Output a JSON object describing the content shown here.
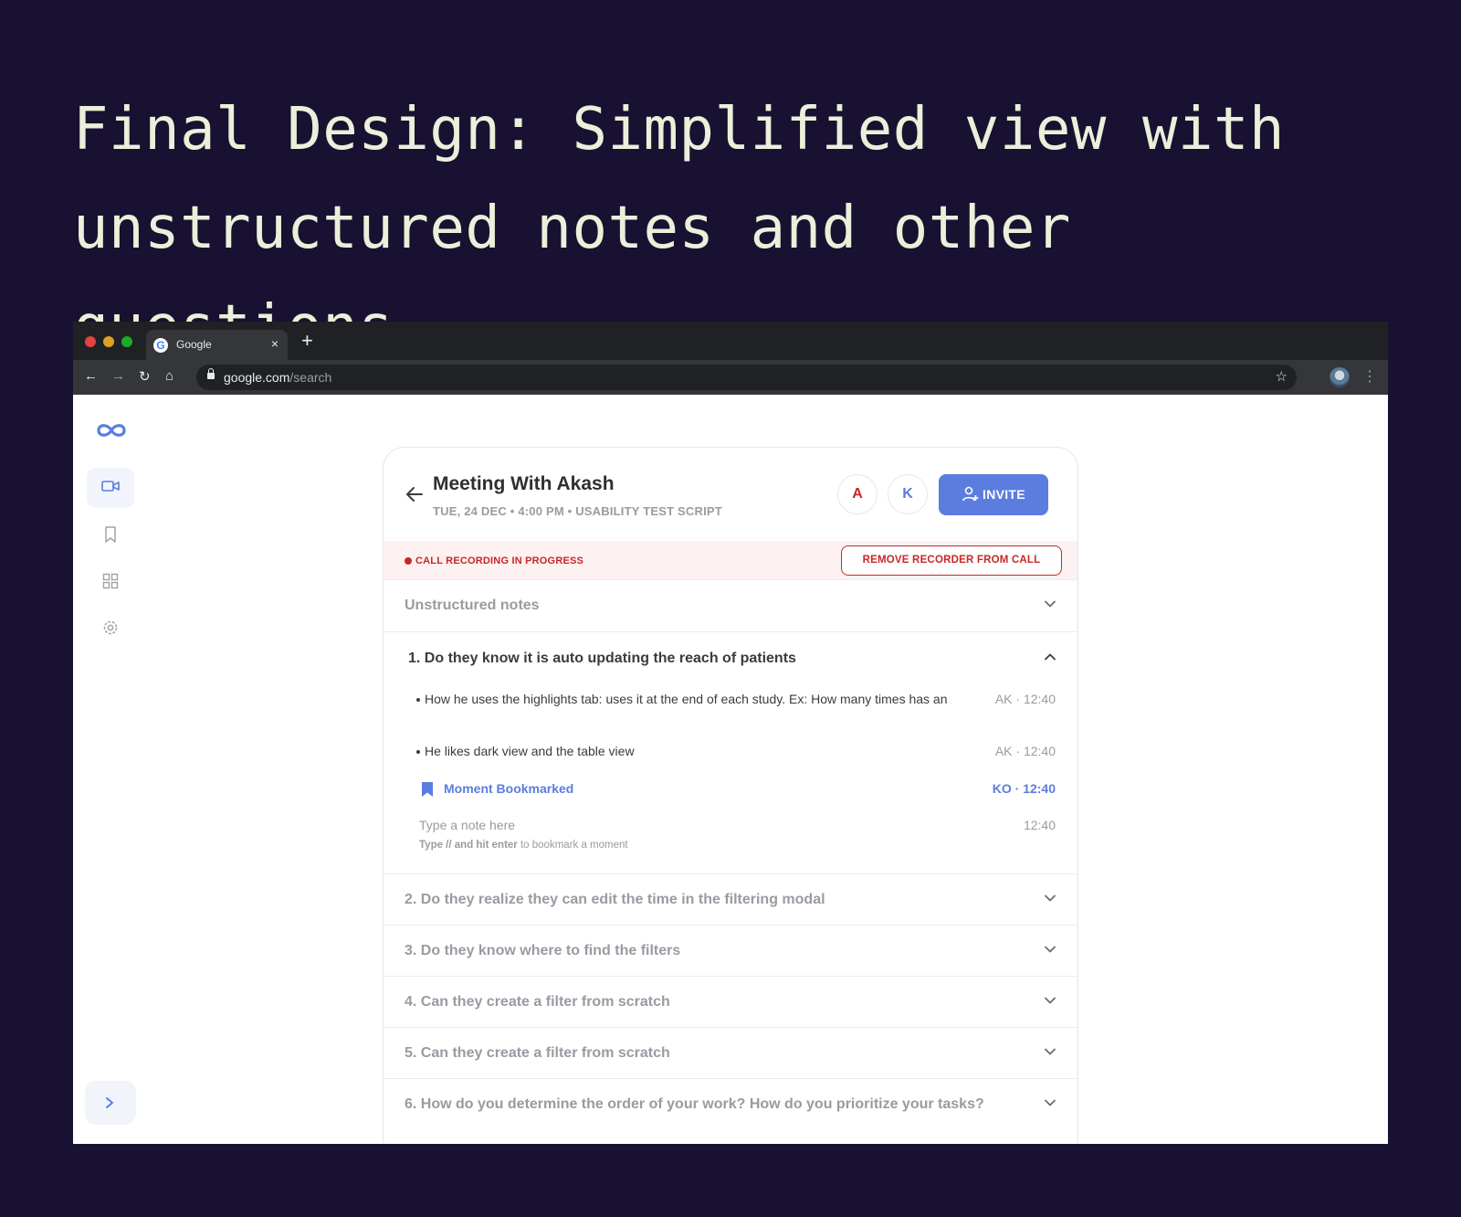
{
  "hero": {
    "title": "Final Design: Simplified view with unstructured notes and other questions"
  },
  "browser": {
    "tab_title": "Google",
    "tab_close": "×",
    "new_tab": "+",
    "url_domain": "google.com",
    "url_path": "/search"
  },
  "sidebar": {
    "items": [
      {
        "icon": "video-camera-icon",
        "active": true
      },
      {
        "icon": "bookmark-icon",
        "active": false
      },
      {
        "icon": "grid-icon",
        "active": false
      },
      {
        "icon": "gear-icon",
        "active": false
      }
    ]
  },
  "meeting": {
    "title": "Meeting With Akash",
    "subtitle": "TUE, 24 DEC • 4:00 PM • USABILITY TEST SCRIPT",
    "participants": [
      "A",
      "K"
    ],
    "invite_label": "INVITE"
  },
  "recording": {
    "status": "CALL RECORDING IN PROGRESS",
    "remove_label": "REMOVE RECORDER  FROM CALL"
  },
  "unstructured": {
    "label": "Unstructured notes"
  },
  "open_question": {
    "title": "1. Do they know it is auto updating the reach of patients",
    "notes": [
      {
        "text": "How he uses the highlights tab: uses it at the end of each study. Ex: How many times has an",
        "meta": "AK · 12:40"
      },
      {
        "text": "He likes dark view and the table view",
        "meta": "AK · 12:40"
      }
    ],
    "bookmark": {
      "label": "Moment Bookmarked",
      "meta": "KO · 12:40"
    },
    "input_placeholder": "Type a note here",
    "input_time": "12:40",
    "hint_strong": "Type // and hit enter",
    "hint_rest": " to bookmark a moment"
  },
  "questions": [
    {
      "label": "2. Do they realize they can edit the time in the filtering modal"
    },
    {
      "label": "3. Do they know where to find the filters"
    },
    {
      "label": "4. Can they create a filter from scratch"
    },
    {
      "label": "5. Can they create a filter from scratch"
    },
    {
      "label": "6. How do you determine the order of your work? How do you prioritize your tasks?"
    }
  ],
  "colors": {
    "background": "#181132",
    "hero_text": "#ecefd9",
    "accent": "#5a7ddf",
    "danger": "#c62828"
  }
}
